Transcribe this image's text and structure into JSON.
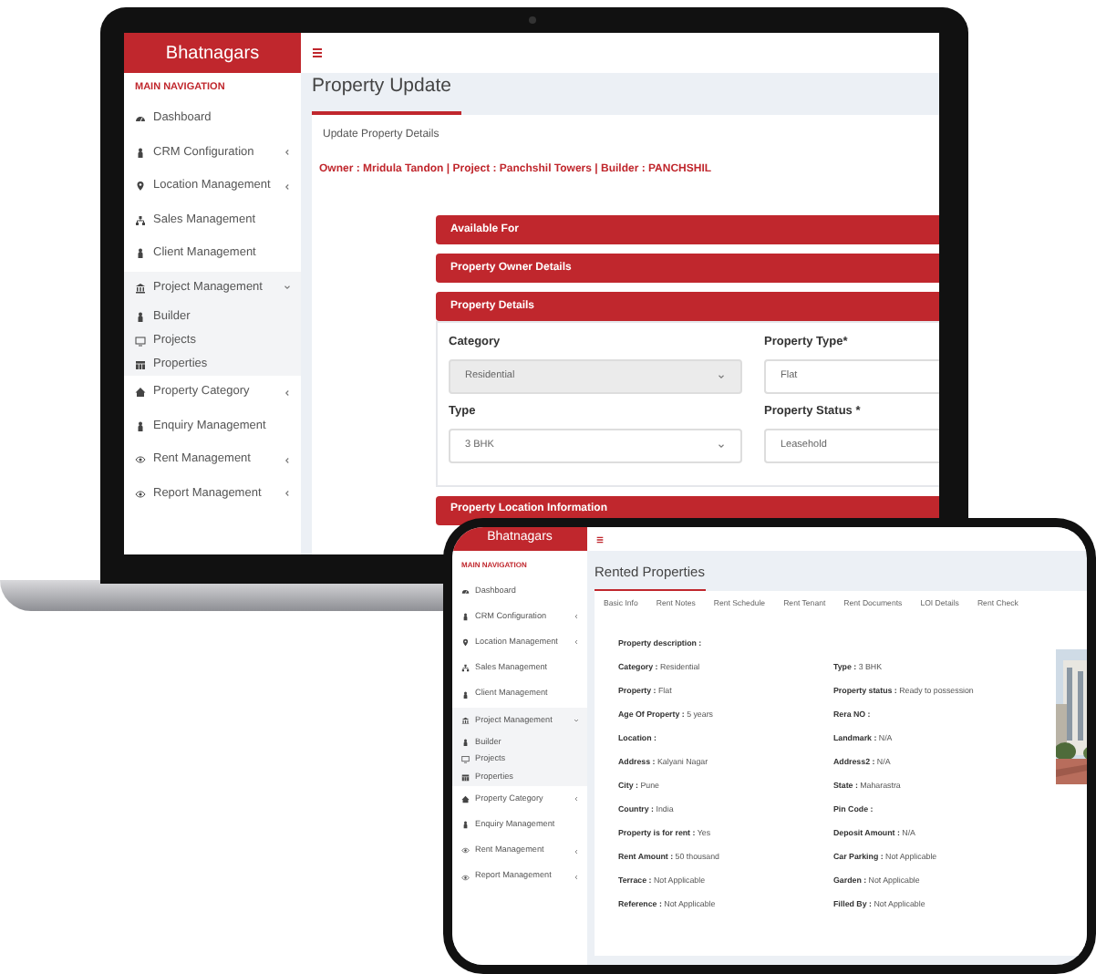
{
  "laptop": {
    "brand": "Bhatnagars",
    "nav_heading": "MAIN NAVIGATION",
    "nav": [
      {
        "label": "Dashboard"
      },
      {
        "label": "CRM Configuration",
        "expanded": false
      },
      {
        "label": "Location Management",
        "expanded": false
      },
      {
        "label": "Sales Management"
      },
      {
        "label": "Client Management"
      },
      {
        "label": "Project Management",
        "expanded": true,
        "children": [
          {
            "label": "Builder"
          },
          {
            "label": "Projects"
          },
          {
            "label": "Properties"
          }
        ]
      },
      {
        "label": "Property Category",
        "expanded": false
      },
      {
        "label": "Enquiry Management"
      },
      {
        "label": "Rent Management",
        "expanded": false
      },
      {
        "label": "Report Management",
        "expanded": false
      }
    ],
    "page_title": "Property Update",
    "subtitle": "Update Property Details",
    "owner_line": "Owner : Mridula Tandon | Project : Panchshil Towers | Builder : PANCHSHIL",
    "sections": [
      {
        "title": "Available For"
      },
      {
        "title": "Property Owner Details"
      },
      {
        "title": "Property Details",
        "fields": [
          {
            "label": "Category",
            "kind": "select",
            "value": "Residential",
            "disabled": true
          },
          {
            "label": "Property Type*",
            "kind": "input",
            "value": "Flat",
            "disabled": false
          },
          {
            "label": "Type",
            "kind": "select",
            "value": "3 BHK",
            "disabled": false
          },
          {
            "label": "Property Status *",
            "kind": "input",
            "value": "Leasehold",
            "disabled": false
          }
        ]
      },
      {
        "title": "Property Location Information"
      }
    ]
  },
  "tablet": {
    "brand": "Bhatnagars",
    "nav_heading": "MAIN NAVIGATION",
    "nav": [
      {
        "label": "Dashboard"
      },
      {
        "label": "CRM Configuration",
        "expanded": false
      },
      {
        "label": "Location Management",
        "expanded": false
      },
      {
        "label": "Sales Management"
      },
      {
        "label": "Client Management"
      },
      {
        "label": "Project Management",
        "expanded": true,
        "children": [
          {
            "label": "Builder"
          },
          {
            "label": "Projects"
          },
          {
            "label": "Properties"
          }
        ]
      },
      {
        "label": "Property Category",
        "expanded": false
      },
      {
        "label": "Enquiry Management"
      },
      {
        "label": "Rent Management",
        "expanded": false
      },
      {
        "label": "Report Management",
        "expanded": false
      }
    ],
    "page_title": "Rented Properties",
    "tabs": [
      "Basic Info",
      "Rent Notes",
      "Rent Schedule",
      "Rent Tenant",
      "Rent Documents",
      "LOI Details",
      "Rent Check"
    ],
    "description_label": "Property description :",
    "details": [
      {
        "label": "Category :",
        "value": "Residential"
      },
      {
        "label": "Type :",
        "value": "3 BHK"
      },
      {
        "label": "Property :",
        "value": "Flat"
      },
      {
        "label": "Property status :",
        "value": "Ready to possession"
      },
      {
        "label": "Age Of Property :",
        "value": "5 years"
      },
      {
        "label": "Rera NO :"
      },
      {
        "label": "Location :"
      },
      {
        "label": "Landmark :",
        "value": "N/A"
      },
      {
        "label": "Address :",
        "value": "Kalyani Nagar"
      },
      {
        "label": "Address2 :",
        "value": "N/A"
      },
      {
        "label": "City :",
        "value": "Pune"
      },
      {
        "label": "State :",
        "value": "Maharastra"
      },
      {
        "label": "Country :",
        "value": "India"
      },
      {
        "label": "Pin Code :"
      },
      {
        "label": "Property is for rent :",
        "value": "Yes"
      },
      {
        "label": "Deposit Amount :",
        "value": "N/A"
      },
      {
        "label": "Rent Amount :",
        "value": "50  thousand"
      },
      {
        "label": "Car Parking :",
        "value": "Not Applicable"
      },
      {
        "label": "Terrace :",
        "value": "Not Applicable"
      },
      {
        "label": "Garden :",
        "value": "Not Applicable"
      },
      {
        "label": "Reference :",
        "value": "Not Applicable"
      },
      {
        "label": "Filled By :",
        "value": "Not Applicable"
      }
    ]
  }
}
